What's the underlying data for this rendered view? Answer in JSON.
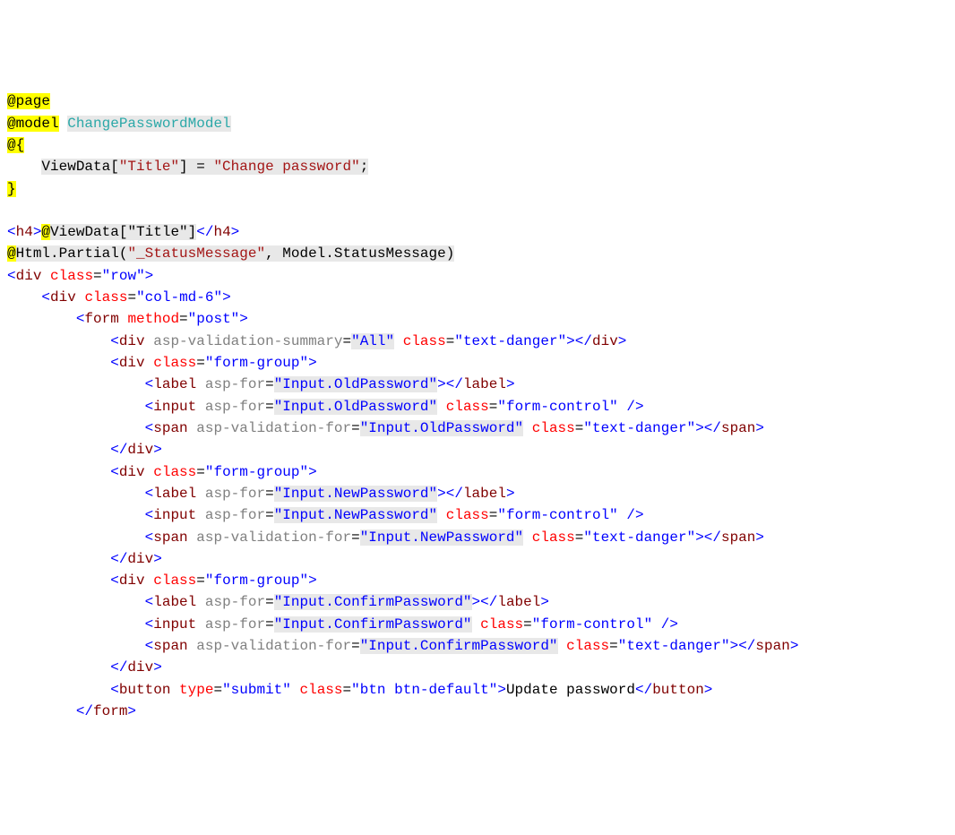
{
  "razor": {
    "page": "@page",
    "model_kw": "@model",
    "model_type": "ChangePasswordModel",
    "block_open": "@{",
    "viewdata_lhs": "ViewData[",
    "title_key": "\"Title\"",
    "viewdata_mid": "] = ",
    "title_val": "\"Change password\"",
    "viewdata_end": ";",
    "block_close": "}",
    "h4_open_tag": "h4",
    "h4_expr_at": "@",
    "h4_expr_body": "ViewData[\"Title\"]",
    "h4_close_tag": "h4",
    "partial_at": "@",
    "partial_call1": "Html.Partial(",
    "partial_arg1": "\"_StatusMessage\"",
    "partial_call2": ", Model.StatusMessage)"
  },
  "tags": {
    "div": "div",
    "form": "form",
    "label": "label",
    "input": "input",
    "span": "span",
    "button": "button"
  },
  "attrs": {
    "class": "class",
    "method": "method",
    "asp_for": "asp-for",
    "asp_validation_for": "asp-validation-for",
    "asp_validation_summary": "asp-validation-summary",
    "type": "type"
  },
  "vals": {
    "row": "\"row\"",
    "col": "\"col-md-6\"",
    "post": "\"post\"",
    "all": "\"All\"",
    "text_danger": "\"text-danger\"",
    "form_group": "\"form-group\"",
    "form_control": "\"form-control\"",
    "old_pw": "\"Input.OldPassword\"",
    "new_pw": "\"Input.NewPassword\"",
    "confirm_pw": "\"Input.ConfirmPassword\"",
    "submit": "\"submit\"",
    "btn": "\"btn btn-default\""
  },
  "text": {
    "update_pw": "Update password"
  },
  "gutter": {
    "blank": " ",
    "box": " ",
    "cont": " ",
    "end": " "
  }
}
